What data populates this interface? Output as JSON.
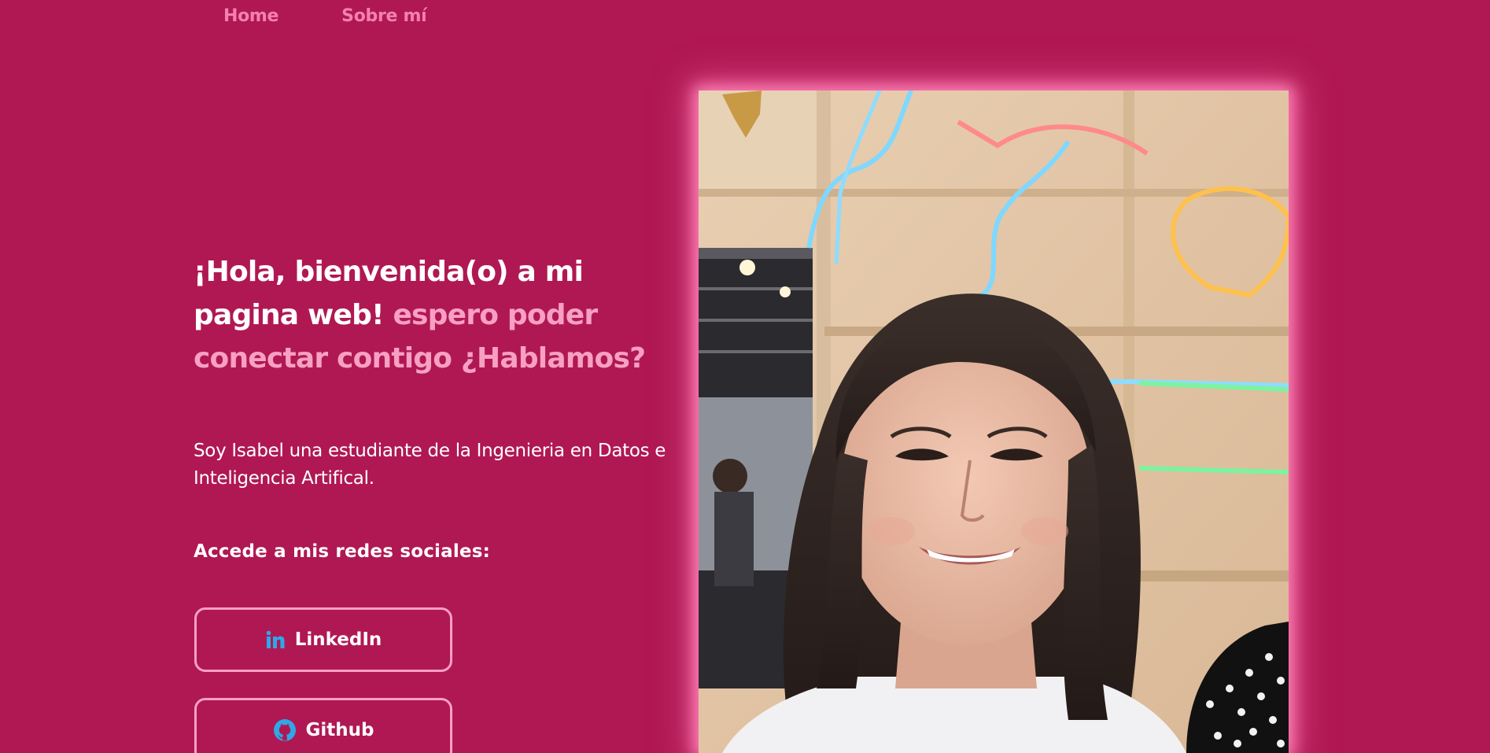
{
  "nav": {
    "items": [
      {
        "label": "Home"
      },
      {
        "label": "Sobre mí"
      }
    ]
  },
  "hero": {
    "heading_main": "¡Hola, bienvenida(o) a mi pagina web!",
    "heading_accent": "espero poder conectar contigo ¿Hablamos?"
  },
  "intro": {
    "text": "Soy Isabel una estudiante de la Ingenieria en Datos e Inteligencia Artifical."
  },
  "social": {
    "title": "Accede a mis redes sociales:",
    "buttons": [
      {
        "label": "LinkedIn",
        "icon": "linkedin-icon"
      },
      {
        "label": "Github",
        "icon": "github-icon"
      }
    ]
  },
  "photo": {
    "subject": "profile-photo"
  },
  "colors": {
    "background": "#B01853",
    "nav_link": "#F480AE",
    "accent_text": "#F7A0C2",
    "button_border": "#F7A0C2",
    "icon_blue": "#2EA8E6",
    "photo_glow": "#FF7FB6"
  }
}
